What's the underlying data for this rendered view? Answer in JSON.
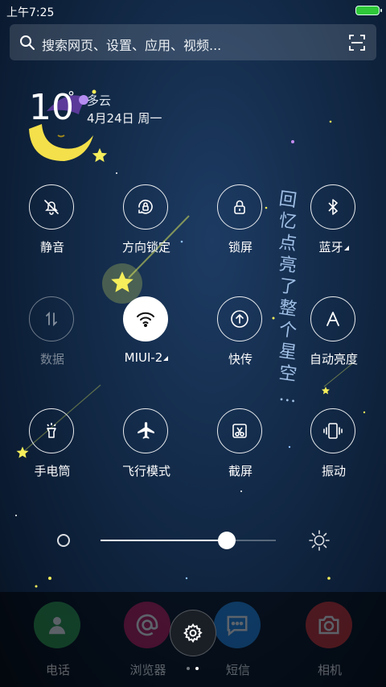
{
  "status_bar": {
    "time": "上午7:25",
    "battery_color": "#2ec83a"
  },
  "search": {
    "placeholder": "搜索网页、设置、应用、视频..."
  },
  "weather": {
    "temperature": "10",
    "degree": "°",
    "condition": "多云",
    "date": "4月24日 周一"
  },
  "toggles": [
    {
      "label": "静音",
      "icon": "bell-off-icon",
      "state": "off"
    },
    {
      "label": "方向锁定",
      "icon": "rotation-lock-icon",
      "state": "off"
    },
    {
      "label": "锁屏",
      "icon": "lock-icon",
      "state": "off"
    },
    {
      "label": "蓝牙",
      "icon": "bluetooth-icon",
      "state": "off"
    },
    {
      "label": "数据",
      "icon": "mobile-data-icon",
      "state": "disabled"
    },
    {
      "label": "MIUI-2",
      "icon": "wifi-icon",
      "state": "on"
    },
    {
      "label": "快传",
      "icon": "share-upload-icon",
      "state": "off"
    },
    {
      "label": "自动亮度",
      "icon": "auto-brightness-icon",
      "state": "off"
    },
    {
      "label": "手电筒",
      "icon": "flashlight-icon",
      "state": "off"
    },
    {
      "label": "飞行模式",
      "icon": "airplane-icon",
      "state": "off"
    },
    {
      "label": "截屏",
      "icon": "screenshot-icon",
      "state": "off"
    },
    {
      "label": "振动",
      "icon": "vibrate-icon",
      "state": "off"
    }
  ],
  "brightness": {
    "level": 0.72
  },
  "dock": {
    "apps": [
      {
        "label": "电话",
        "icon": "phone-icon",
        "color": "#2e9e4a"
      },
      {
        "label": "浏览器",
        "icon": "browser-icon",
        "color": "#c2185b"
      },
      {
        "label": "短信",
        "icon": "message-icon",
        "color": "#1e88e5"
      },
      {
        "label": "相机",
        "icon": "camera-icon",
        "color": "#d32f2f"
      }
    ],
    "settings_icon": "gear-icon",
    "page_count": 2,
    "active_page": 1
  },
  "wallpaper": {
    "poem": [
      "回",
      "忆",
      "点",
      "亮",
      "了",
      "整",
      "个",
      "星",
      "空",
      "…"
    ]
  },
  "colors": {
    "accent_on": "#ffffff",
    "star": "#f6ee5a",
    "poem": "#b8d8ff"
  }
}
